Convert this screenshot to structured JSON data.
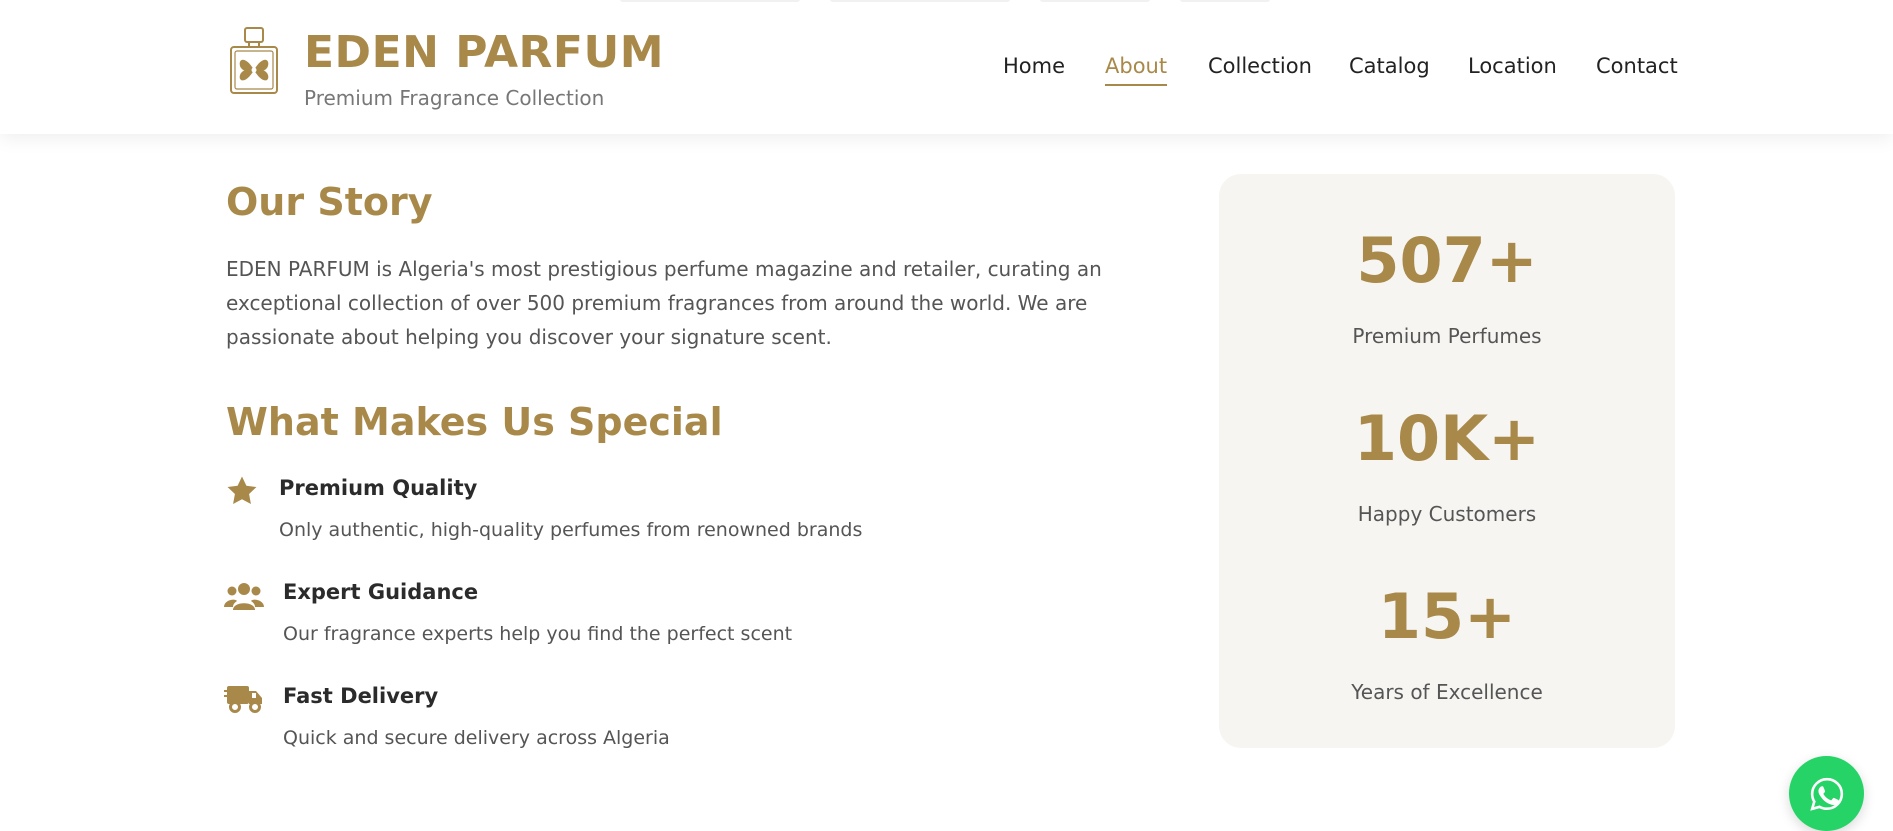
{
  "brand": {
    "name": "EDEN PARFUM",
    "tagline": "Premium Fragrance Collection",
    "logo_icon": "perfume-bottle-icon"
  },
  "nav": {
    "items": [
      {
        "label": "Home",
        "active": false
      },
      {
        "label": "About",
        "active": true
      },
      {
        "label": "Collection",
        "active": false
      },
      {
        "label": "Catalog",
        "active": false
      },
      {
        "label": "Location",
        "active": false
      },
      {
        "label": "Contact",
        "active": false
      }
    ]
  },
  "story": {
    "heading": "Our Story",
    "text": "EDEN PARFUM is Algeria's most prestigious perfume magazine and retailer, curating an exceptional collection of over 500 premium fragrances from around the world. We are passionate about helping you discover your signature scent."
  },
  "special": {
    "heading": "What Makes Us Special",
    "features": [
      {
        "icon": "star-icon",
        "title": "Premium Quality",
        "description": "Only authentic, high-quality perfumes from renowned brands"
      },
      {
        "icon": "users-icon",
        "title": "Expert Guidance",
        "description": "Our fragrance experts help you find the perfect scent"
      },
      {
        "icon": "delivery-truck-icon",
        "title": "Fast Delivery",
        "description": "Quick and secure delivery across Algeria"
      }
    ]
  },
  "stats": [
    {
      "number": "507+",
      "label": "Premium Perfumes"
    },
    {
      "number": "10K+",
      "label": "Happy Customers"
    },
    {
      "number": "15+",
      "label": "Years of Excellence"
    }
  ],
  "whatsapp": {
    "icon": "whatsapp-icon"
  },
  "colors": {
    "accent": "#a8894a",
    "text": "#333333",
    "muted": "#555555",
    "card_bg": "#f6f5f2",
    "whatsapp": "#25d366"
  }
}
